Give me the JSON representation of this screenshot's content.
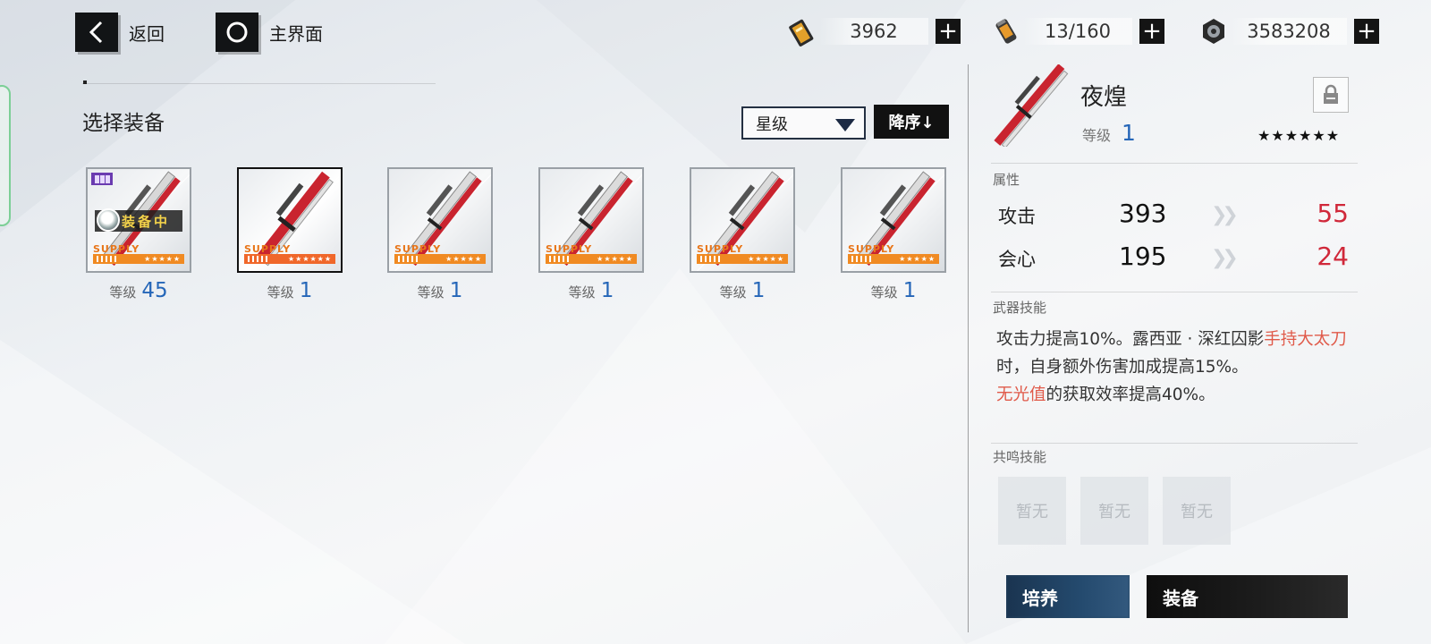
{
  "header": {
    "back_label": "返回",
    "home_label": "主界面",
    "resources": [
      {
        "icon": "gold-ticket-icon",
        "value": "3962",
        "add": "+"
      },
      {
        "icon": "energy-canister-icon",
        "value": "13/160",
        "add": "+"
      },
      {
        "icon": "gear-coin-icon",
        "value": "3583208",
        "add": "+"
      }
    ]
  },
  "selection": {
    "title": "选择装备",
    "sort_select_value": "星级",
    "sort_order_label": "降序↓",
    "items": [
      {
        "supply": "SUPPLY",
        "stars": "★★★★★",
        "level_label": "等级",
        "level": "45",
        "equipped_label": "装备中",
        "selected": false
      },
      {
        "supply": "SUPPLY",
        "stars": "★★★★★★",
        "level_label": "等级",
        "level": "1",
        "selected": true
      },
      {
        "supply": "SUPPLY",
        "stars": "★★★★★",
        "level_label": "等级",
        "level": "1",
        "selected": false
      },
      {
        "supply": "SUPPLY",
        "stars": "★★★★★",
        "level_label": "等级",
        "level": "1",
        "selected": false
      },
      {
        "supply": "SUPPLY",
        "stars": "★★★★★",
        "level_label": "等级",
        "level": "1",
        "selected": false
      },
      {
        "supply": "SUPPLY",
        "stars": "★★★★★",
        "level_label": "等级",
        "level": "1",
        "selected": false
      }
    ]
  },
  "detail": {
    "name": "夜煌",
    "level_label": "等级",
    "level": "1",
    "stars": "★★★★★★",
    "attributes_title": "属性",
    "stats": [
      {
        "name": "攻击",
        "base": "393",
        "bonus": "55"
      },
      {
        "name": "会心",
        "base": "195",
        "bonus": "24"
      }
    ],
    "weapon_skill_title": "武器技能",
    "weapon_skill": {
      "p1": "攻击力提高10%。露西亚 · 深红囚影",
      "h1": "手持大太刀",
      "p2": "时，自身额外伤害加成提高15%。",
      "h2": "无光值",
      "p3": "的获取效率提高40%。"
    },
    "resonance_title": "共鸣技能",
    "resonance_slots": [
      "暂无",
      "暂无",
      "暂无"
    ],
    "train_label": "培养",
    "equip_label": "装备"
  },
  "colors": {
    "accent_blue": "#2566b8",
    "bonus_red": "#d0283a",
    "highlight_red": "#e05a4a",
    "supply_orange": "#f08a22"
  }
}
